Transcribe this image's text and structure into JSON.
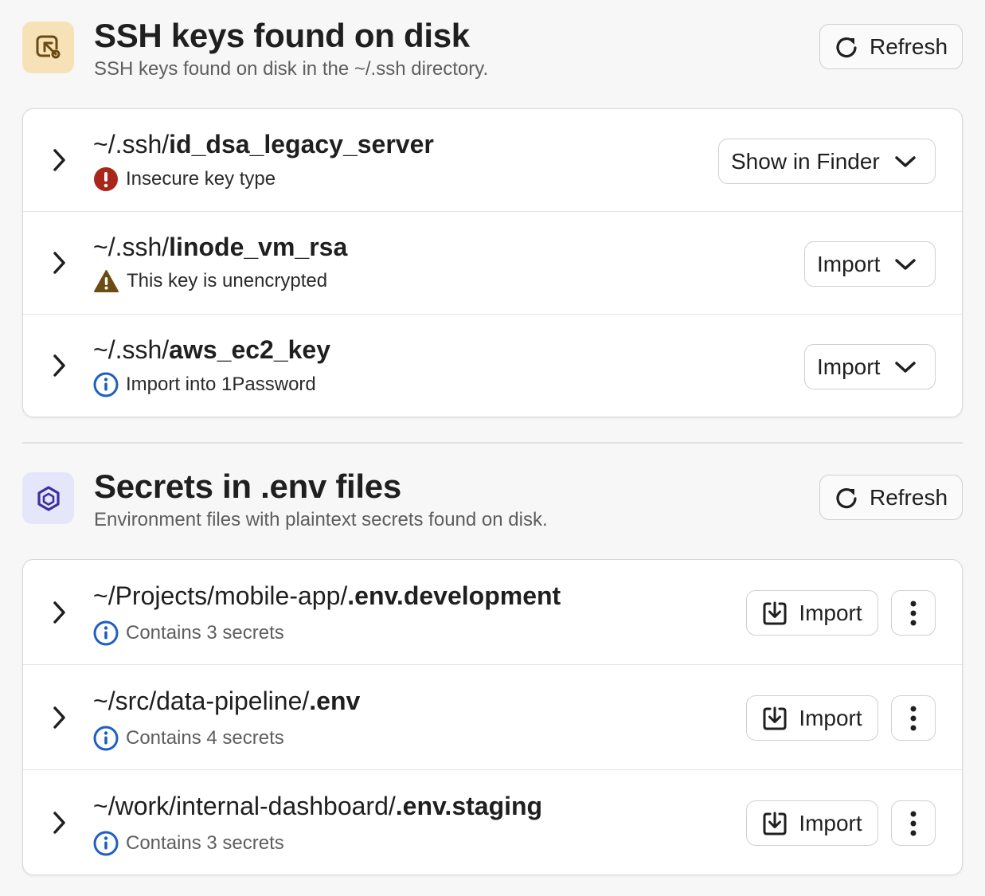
{
  "ssh_section": {
    "title": "SSH keys found on disk",
    "subtitle": "SSH keys found on disk in the ~/.ssh directory.",
    "refresh_label": "Refresh",
    "icon": "key-file-icon",
    "icon_bg": "#f7e2b8",
    "icon_color": "#6b4a14",
    "items": [
      {
        "path_prefix": "~/.ssh/",
        "path_name": "id_dsa_legacy_server",
        "status_icon": "error-icon",
        "status_color": "#a8261a",
        "status_text": "Insecure key type",
        "action_label": "Show in Finder"
      },
      {
        "path_prefix": "~/.ssh/",
        "path_name": "linode_vm_rsa",
        "status_icon": "warning-icon",
        "status_color": "#6b4d14",
        "status_text": "This key is unencrypted",
        "action_label": "Import"
      },
      {
        "path_prefix": "~/.ssh/",
        "path_name": "aws_ec2_key",
        "status_icon": "info-icon",
        "status_color": "#1f5fbf",
        "status_text": "Import into 1Password",
        "action_label": "Import"
      }
    ]
  },
  "env_section": {
    "title": "Secrets in .env files",
    "subtitle": "Environment files with plaintext secrets found on disk.",
    "refresh_label": "Refresh",
    "icon": "cube-icon",
    "icon_bg": "#e6e6fb",
    "icon_color": "#3e2f9e",
    "items": [
      {
        "path_prefix": "~/Projects/mobile-app/",
        "path_name": ".env.development",
        "status_icon": "info-icon",
        "status_color": "#1f5fbf",
        "status_text": "Contains 3 secrets",
        "action_label": "Import"
      },
      {
        "path_prefix": "~/src/data-pipeline/",
        "path_name": ".env",
        "status_icon": "info-icon",
        "status_color": "#1f5fbf",
        "status_text": "Contains 4 secrets",
        "action_label": "Import"
      },
      {
        "path_prefix": "~/work/internal-dashboard/",
        "path_name": ".env.staging",
        "status_icon": "info-icon",
        "status_color": "#1f5fbf",
        "status_text": "Contains 3 secrets",
        "action_label": "Import"
      }
    ]
  }
}
